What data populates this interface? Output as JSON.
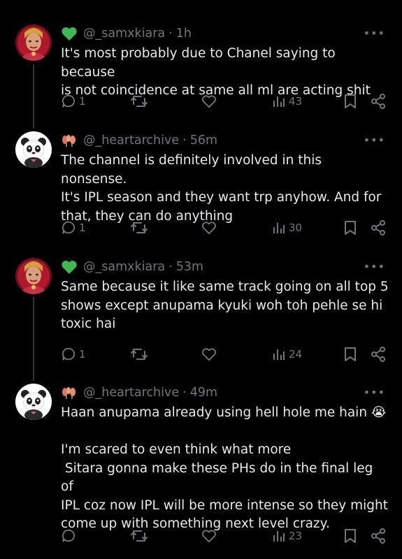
{
  "posts": [
    {
      "username": "@_samxkiara",
      "time": "1h",
      "badge_icon": "green-heart-icon",
      "text": "It's most probably due to Chanel saying to because\nis not coincidence at same all ml are acting shit",
      "replies": "1",
      "reposts": "",
      "views": "43"
    },
    {
      "username": "@_heartarchive",
      "time": "56m",
      "badge_icon": "flowers-icon",
      "text": "The channel is definitely involved in this nonsense.\nIt's IPL season and they want trp anyhow. And for\nthat, they can do anything",
      "replies": "1",
      "reposts": "",
      "views": "30"
    },
    {
      "username": "@_samxkiara",
      "time": "53m",
      "badge_icon": "green-heart-icon",
      "text": "Same because it like same track going on all top 5\nshows except anupama kyuki woh toh pehle se hi\ntoxic hai",
      "replies": "1",
      "reposts": "",
      "views": "24"
    },
    {
      "username": "@_heartarchive",
      "time": "49m",
      "badge_icon": "flowers-icon",
      "text": "Haan anupama already using hell hole me hain 😭\n\nI'm scared to even think what more\n Sitara gonna make these PHs do in the final leg of\nIPL coz now IPL will be more intense so they might\ncome up with something next level crazy.",
      "replies": "",
      "reposts": "",
      "views": "23"
    }
  ],
  "colors": {
    "muted": "#71767b",
    "text": "#e7e9ea",
    "green": "#3fb950",
    "bg": "#000000"
  },
  "separator": "·"
}
